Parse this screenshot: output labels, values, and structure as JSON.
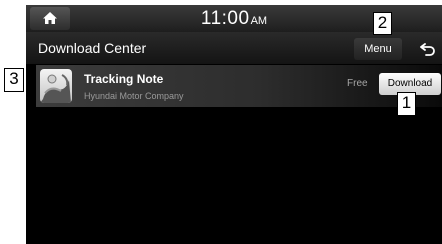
{
  "statusbar": {
    "time": "11:00",
    "ampm": "AM"
  },
  "header": {
    "title": "Download Center",
    "menu_label": "Menu"
  },
  "apps": [
    {
      "name": "Tracking Note",
      "company": "Hyundai Motor Company",
      "price": "Free",
      "action_label": "Download"
    }
  ],
  "callouts": {
    "download": "1",
    "menu": "2",
    "app_icon": "3"
  },
  "icons": {
    "home": "home-icon",
    "back": "back-arrow-icon",
    "app": "tracking-note-app-icon"
  }
}
